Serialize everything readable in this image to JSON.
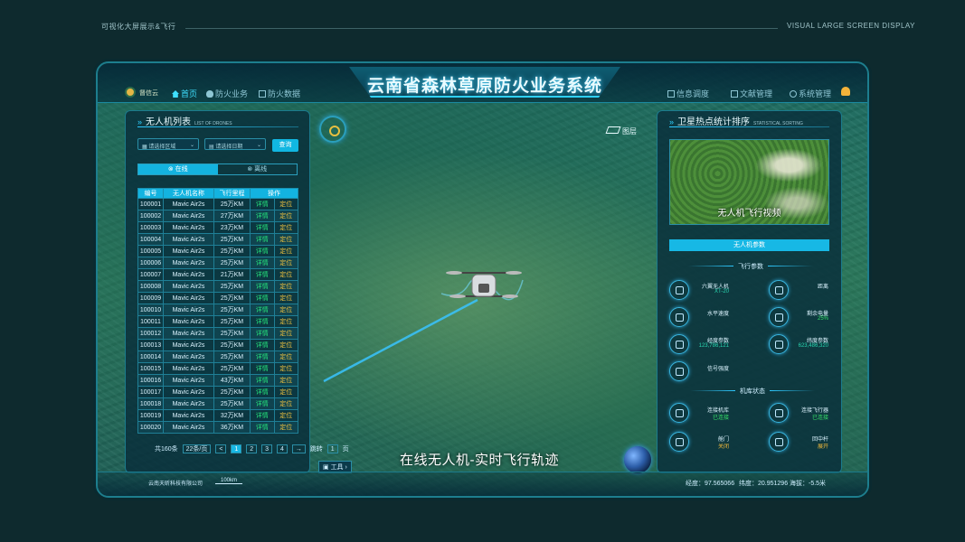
{
  "caption_left": "可视化大屏展示&飞行",
  "caption_right": "VISUAL LARGE SCREEN DISPLAY",
  "header": {
    "title": "云南省森林草原防火业务系统",
    "logo_text": "督信云",
    "nav_left": [
      "首页",
      "防火业务",
      "防火数据"
    ],
    "nav_right": [
      "信息调度",
      "文献管理",
      "系统管理"
    ]
  },
  "left_panel": {
    "title": "无人机列表",
    "title_en": "LIST OF DRONES",
    "area_placeholder": "请选择区域",
    "date_placeholder": "请选择日期",
    "query_label": "查询",
    "tab_online": "在线",
    "tab_offline": "离线",
    "columns": [
      "编号",
      "无人机名称",
      "飞行里程",
      "操作"
    ],
    "rows": [
      [
        "100001",
        "Mavic Air2s",
        "25万KM",
        "详情",
        "定位"
      ],
      [
        "100002",
        "Mavic Air2s",
        "27万KM",
        "详情",
        "定位"
      ],
      [
        "100003",
        "Mavic Air2s",
        "23万KM",
        "详情",
        "定位"
      ],
      [
        "100004",
        "Mavic Air2s",
        "25万KM",
        "详情",
        "定位"
      ],
      [
        "100005",
        "Mavic Air2s",
        "25万KM",
        "详情",
        "定位"
      ],
      [
        "100006",
        "Mavic Air2s",
        "25万KM",
        "详情",
        "定位"
      ],
      [
        "100007",
        "Mavic Air2s",
        "21万KM",
        "详情",
        "定位"
      ],
      [
        "100008",
        "Mavic Air2s",
        "25万KM",
        "详情",
        "定位"
      ],
      [
        "100009",
        "Mavic Air2s",
        "25万KM",
        "详情",
        "定位"
      ],
      [
        "100010",
        "Mavic Air2s",
        "25万KM",
        "详情",
        "定位"
      ],
      [
        "100011",
        "Mavic Air2s",
        "25万KM",
        "详情",
        "定位"
      ],
      [
        "100012",
        "Mavic Air2s",
        "25万KM",
        "详情",
        "定位"
      ],
      [
        "100013",
        "Mavic Air2s",
        "25万KM",
        "详情",
        "定位"
      ],
      [
        "100014",
        "Mavic Air2s",
        "25万KM",
        "详情",
        "定位"
      ],
      [
        "100015",
        "Mavic Air2s",
        "25万KM",
        "详情",
        "定位"
      ],
      [
        "100016",
        "Mavic Air2s",
        "43万KM",
        "详情",
        "定位"
      ],
      [
        "100017",
        "Mavic Air2s",
        "25万KM",
        "详情",
        "定位"
      ],
      [
        "100018",
        "Mavic Air2s",
        "25万KM",
        "详情",
        "定位"
      ],
      [
        "100019",
        "Mavic Air2s",
        "32万KM",
        "详情",
        "定位"
      ],
      [
        "100020",
        "Mavic Air2s",
        "36万KM",
        "详情",
        "定位"
      ]
    ],
    "pager": {
      "total": "共160条",
      "per_page": "22条/页",
      "prev": "<",
      "pages": [
        "1",
        "2",
        "3",
        "4"
      ],
      "next": "→",
      "jump_label": "跳转",
      "jump_value": "1",
      "page_suffix": "页"
    }
  },
  "map": {
    "layer_label": "图层",
    "subtitle": "在线无人机-实时飞行轨迹",
    "tool_label": "工具"
  },
  "right_panel": {
    "title": "卫星热点统计排序",
    "title_en": "STATISTICAL SORTING",
    "video_caption": "无人机飞行视频",
    "params_bar": "无人机参数",
    "flight_section": "飞行参数",
    "params": [
      {
        "label": "六翼无人机",
        "value": "XT-20",
        "color": "teal"
      },
      {
        "label": "距离",
        "value": "",
        "color": "teal"
      },
      {
        "label": "水平速度",
        "value": "",
        "color": "teal"
      },
      {
        "label": "剩余电量",
        "value": "25%",
        "color": "green"
      },
      {
        "label": "经度参数",
        "value": "123,786,121",
        "color": "teal"
      },
      {
        "label": "纬度参数",
        "value": "623,486,320",
        "color": "teal"
      },
      {
        "label": "信号强度",
        "value": "",
        "color": "teal"
      }
    ],
    "hangar_section": "机库状态",
    "hangar": [
      {
        "label": "连接机库",
        "value": "已连接",
        "color": "green"
      },
      {
        "label": "连接飞行器",
        "value": "已连接",
        "color": "green"
      },
      {
        "label": "舱门",
        "value": "关闭",
        "color": "orange"
      },
      {
        "label": "回中杆",
        "value": "展开",
        "color": "orange"
      }
    ]
  },
  "footer": {
    "company": "云南天昕科技有限公司",
    "scale": "100km",
    "longitude": "经度：97.565066",
    "latitude": "纬度：20.951296",
    "altitude": "海拔：-5.5米"
  }
}
